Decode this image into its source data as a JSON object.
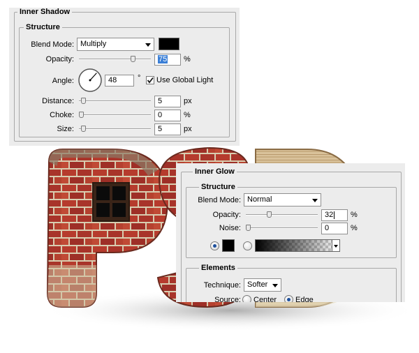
{
  "inner_shadow": {
    "title": "Inner Shadow",
    "structure_title": "Structure",
    "blend_mode_label": "Blend Mode:",
    "blend_mode_value": "Multiply",
    "color": "#000000",
    "opacity_label": "Opacity:",
    "opacity_value": "75",
    "opacity_unit": "%",
    "opacity_level": 0.75,
    "angle_label": "Angle:",
    "angle_value": "48",
    "angle_unit": "°",
    "use_global_light_label": "Use Global Light",
    "use_global_light_checked": true,
    "distance_label": "Distance:",
    "distance_value": "5",
    "distance_unit": "px",
    "choke_label": "Choke:",
    "choke_value": "0",
    "choke_unit": "%",
    "size_label": "Size:",
    "size_value": "5",
    "size_unit": "px"
  },
  "inner_glow": {
    "title": "Inner Glow",
    "structure_title": "Structure",
    "blend_mode_label": "Blend Mode:",
    "blend_mode_value": "Normal",
    "opacity_label": "Opacity:",
    "opacity_value": "32",
    "opacity_unit": "%",
    "opacity_level": 0.32,
    "noise_label": "Noise:",
    "noise_value": "0",
    "noise_unit": "%",
    "color": "#000000",
    "elements_title": "Elements",
    "technique_label": "Technique:",
    "technique_value": "Softer",
    "source_label": "Source:",
    "source_center_label": "Center",
    "source_edge_label": "Edge"
  },
  "colors": {
    "panel_bg": "#ececec",
    "brick_red": "#b23a2c",
    "mortar": "#d8cdb0",
    "selection_blue": "#3b7fd6"
  }
}
